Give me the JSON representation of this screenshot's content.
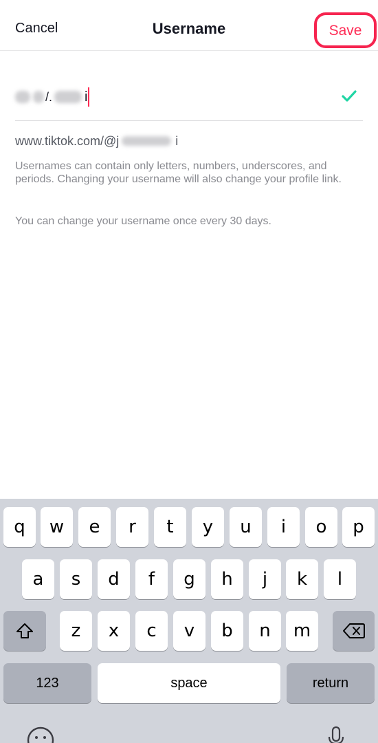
{
  "nav": {
    "cancel_label": "Cancel",
    "title": "Username",
    "save_label": "Save"
  },
  "username_field": {
    "value_visible_fragment": "i",
    "status": "valid"
  },
  "profile_link": {
    "prefix": "www.tiktok.com/@",
    "visible_start": "j",
    "visible_end": "i"
  },
  "help": {
    "rules_text": "Usernames can contain only letters, numbers, underscores, and periods. Changing your username will also change your profile link.",
    "frequency_text": "You can change your username once every 30 days."
  },
  "keyboard": {
    "row1": [
      "q",
      "w",
      "e",
      "r",
      "t",
      "y",
      "u",
      "i",
      "o",
      "p"
    ],
    "row2": [
      "a",
      "s",
      "d",
      "f",
      "g",
      "h",
      "j",
      "k",
      "l"
    ],
    "row3": [
      "z",
      "x",
      "c",
      "v",
      "b",
      "n",
      "m"
    ],
    "numbers_label": "123",
    "space_label": "space",
    "return_label": "return"
  },
  "colors": {
    "accent": "#fe2c55",
    "valid_check": "#20d5a4",
    "keyboard_bg": "#d1d4db"
  },
  "icons": [
    "checkmark-icon",
    "shift-icon",
    "backspace-icon",
    "emoji-icon",
    "microphone-icon"
  ]
}
